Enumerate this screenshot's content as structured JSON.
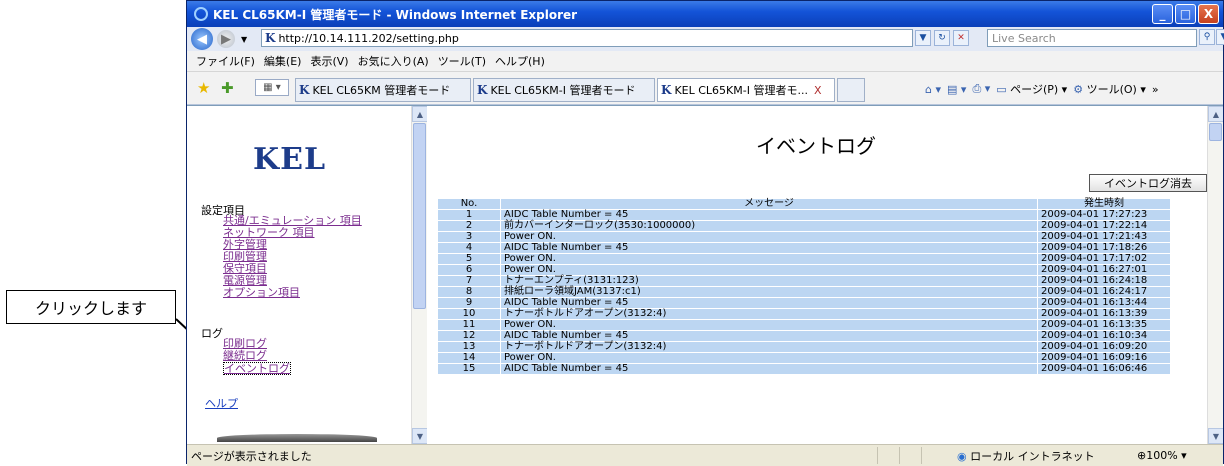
{
  "callout": {
    "text": "クリックします"
  },
  "window": {
    "title": "KEL CL65KM-I 管理者モード - Windows Internet Explorer",
    "buttons": {
      "minimize": "_",
      "maximize": "□",
      "close": "X"
    }
  },
  "address": {
    "url": "http://10.14.111.202/setting.php",
    "search_placeholder": "Live Search"
  },
  "menu": [
    "ファイル(F)",
    "編集(E)",
    "表示(V)",
    "お気に入り(A)",
    "ツール(T)",
    "ヘルプ(H)"
  ],
  "tabs": [
    {
      "label": "KEL CL65KM 管理者モード"
    },
    {
      "label": "KEL CL65KM-I 管理者モード"
    },
    {
      "label": "KEL CL65KM-I 管理者モ...",
      "close": "X"
    }
  ],
  "commands": {
    "page": "ページ(P)",
    "tools": "ツール(O)"
  },
  "sidebar": {
    "logo": "KEL",
    "settings_header": "設定項目",
    "settings_links": [
      "共通/エミュレーション 項目",
      "ネットワーク 項目",
      "外字管理",
      "印刷管理",
      "保守項目",
      "電源管理",
      "オプション項目"
    ],
    "log_header": "ログ",
    "log_links": [
      "印刷ログ",
      "継続ログ",
      "イベントログ"
    ],
    "help_link": "ヘルプ"
  },
  "main": {
    "title": "イベントログ",
    "clear_button": "イベントログ消去",
    "columns": {
      "no": "No.",
      "message": "メッセージ",
      "time": "発生時刻"
    },
    "rows": [
      {
        "no": "1",
        "message": "AIDC Table Number = 45",
        "time": "2009-04-01 17:27:23"
      },
      {
        "no": "2",
        "message": "前カバーインターロック(3530:1000000)",
        "time": "2009-04-01 17:22:14"
      },
      {
        "no": "3",
        "message": "Power ON.",
        "time": "2009-04-01 17:21:43"
      },
      {
        "no": "4",
        "message": "AIDC Table Number = 45",
        "time": "2009-04-01 17:18:26"
      },
      {
        "no": "5",
        "message": "Power ON.",
        "time": "2009-04-01 17:17:02"
      },
      {
        "no": "6",
        "message": "Power ON.",
        "time": "2009-04-01 16:27:01"
      },
      {
        "no": "7",
        "message": "トナーエンプティ(3131:123)",
        "time": "2009-04-01 16:24:18"
      },
      {
        "no": "8",
        "message": "排紙ローラ領域JAM(3137:c1)",
        "time": "2009-04-01 16:24:17"
      },
      {
        "no": "9",
        "message": "AIDC Table Number = 45",
        "time": "2009-04-01 16:13:44"
      },
      {
        "no": "10",
        "message": "トナーボトルドアオープン(3132:4)",
        "time": "2009-04-01 16:13:39"
      },
      {
        "no": "11",
        "message": "Power ON.",
        "time": "2009-04-01 16:13:35"
      },
      {
        "no": "12",
        "message": "AIDC Table Number = 45",
        "time": "2009-04-01 16:10:34"
      },
      {
        "no": "13",
        "message": "トナーボトルドアオープン(3132:4)",
        "time": "2009-04-01 16:09:20"
      },
      {
        "no": "14",
        "message": "Power ON.",
        "time": "2009-04-01 16:09:16"
      },
      {
        "no": "15",
        "message": "AIDC Table Number = 45",
        "time": "2009-04-01 16:06:46"
      }
    ]
  },
  "status": {
    "text": "ページが表示されました",
    "zone": "ローカル イントラネット",
    "zoom": "100%"
  }
}
